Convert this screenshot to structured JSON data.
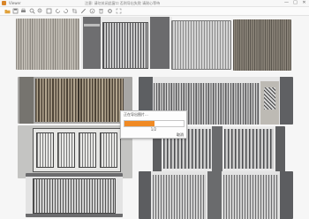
{
  "window": {
    "app_name": "Viewer",
    "title": "注意: 请勿关闭此窗口 否则导出失败 请耐心等待",
    "minimize_label": "—",
    "maximize_label": "□",
    "close_label": "✕"
  },
  "toolbar": {
    "tools": [
      "open-folder-icon",
      "save-icon",
      "print-icon",
      "zoom-in-icon",
      "zoom-out-icon",
      "fit-icon",
      "rotate-left-icon",
      "rotate-right-icon",
      "crop-icon",
      "brush-icon",
      "info-icon",
      "delete-icon",
      "settings-icon",
      "fullscreen-icon"
    ]
  },
  "thumbnails": [
    {
      "name": "gate-wooden-slats",
      "style": "wood-slats"
    },
    {
      "name": "gate-double-door-pillars",
      "style": "pillar-gate"
    },
    {
      "name": "gate-horizontal-panel",
      "style": "hslats"
    },
    {
      "name": "gate-dark-wood",
      "style": "dark-wood"
    },
    {
      "name": "gate-bronze-vertical",
      "style": "bronze"
    },
    {
      "name": "gate-lattice-pillar",
      "style": "lattice"
    },
    {
      "name": "gate-stone-wall-panels",
      "style": "stone-panels"
    },
    {
      "name": "gate-geometric-screen",
      "style": "geometric"
    },
    {
      "name": "gate-sliding-frame",
      "style": "sliding"
    },
    {
      "name": "gate-modern-panels",
      "style": "modern"
    }
  ],
  "dialog": {
    "title": "正在导出图片...",
    "progress": 0.5,
    "progress_text": "1/2",
    "cancel_label": "取消"
  },
  "colors": {
    "accent": "#f08a24",
    "background": "#f6f6f6",
    "titlebar": "#f7f7f7"
  }
}
